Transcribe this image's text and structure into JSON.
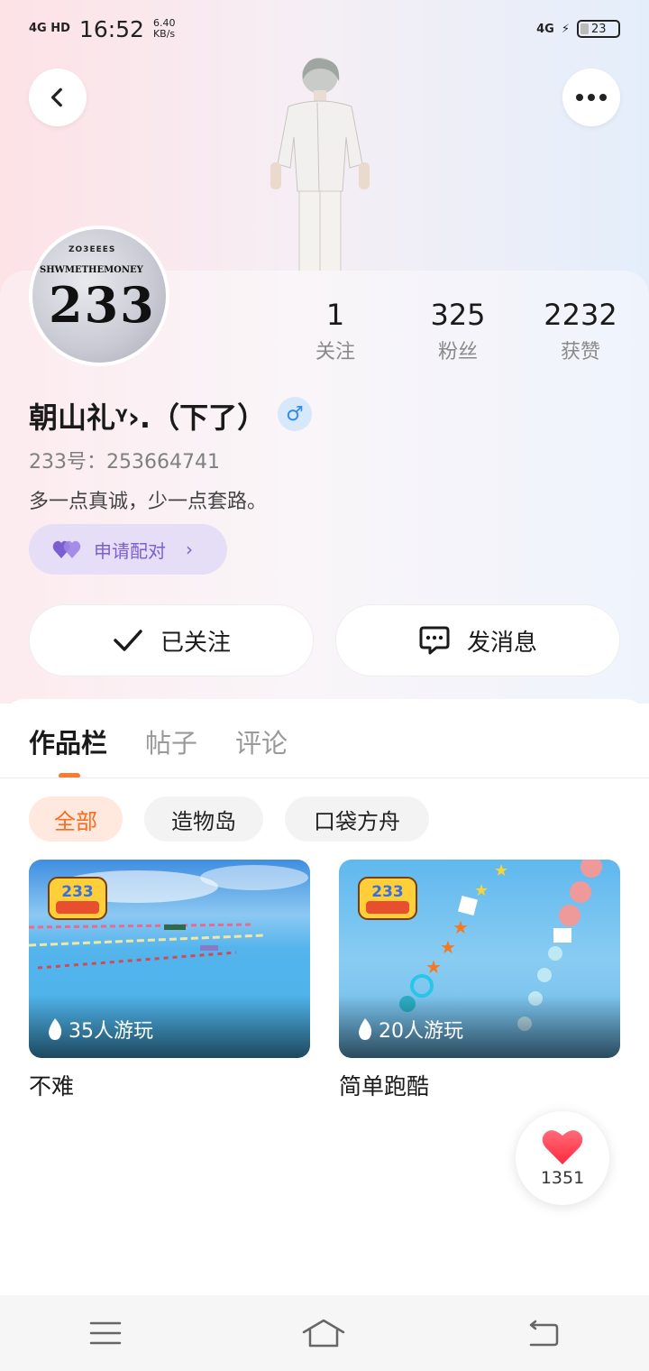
{
  "status_bar": {
    "network": "4G HD",
    "time": "16:52",
    "speed_value": "6.40",
    "speed_unit": "KB/s",
    "network_right": "4G",
    "battery": "23"
  },
  "profile": {
    "avatar_small_text": "ZO3EEES",
    "avatar_line_text": "SHWMETHEMONEY",
    "avatar_big_text": "233",
    "stats": [
      {
        "value": "1",
        "label": "关注"
      },
      {
        "value": "325",
        "label": "粉丝"
      },
      {
        "value": "2232",
        "label": "获赞"
      }
    ],
    "nickname": "朝山礼ᵞ›.（下了）",
    "gender_icon": "♂",
    "id_line": "233号：253664741",
    "bio": "多一点真诚，少一点套路。",
    "pair_label": "申请配对"
  },
  "actions": {
    "follow_label": "已关注",
    "message_label": "发消息"
  },
  "tabs": [
    {
      "label": "作品栏",
      "active": true
    },
    {
      "label": "帖子",
      "active": false
    },
    {
      "label": "评论",
      "active": false
    }
  ],
  "filters": [
    {
      "label": "全部",
      "active": true
    },
    {
      "label": "造物岛",
      "active": false
    },
    {
      "label": "口袋方舟",
      "active": false
    }
  ],
  "games": [
    {
      "plays": "35人游玩",
      "title": "不难"
    },
    {
      "plays": "20人游玩",
      "title": "简单跑酷"
    }
  ],
  "like_count": "1351",
  "colors": {
    "accent_orange": "#ff6a1a",
    "pair_purple": "#7b5fd1",
    "like_red": "#ff3b4e"
  }
}
